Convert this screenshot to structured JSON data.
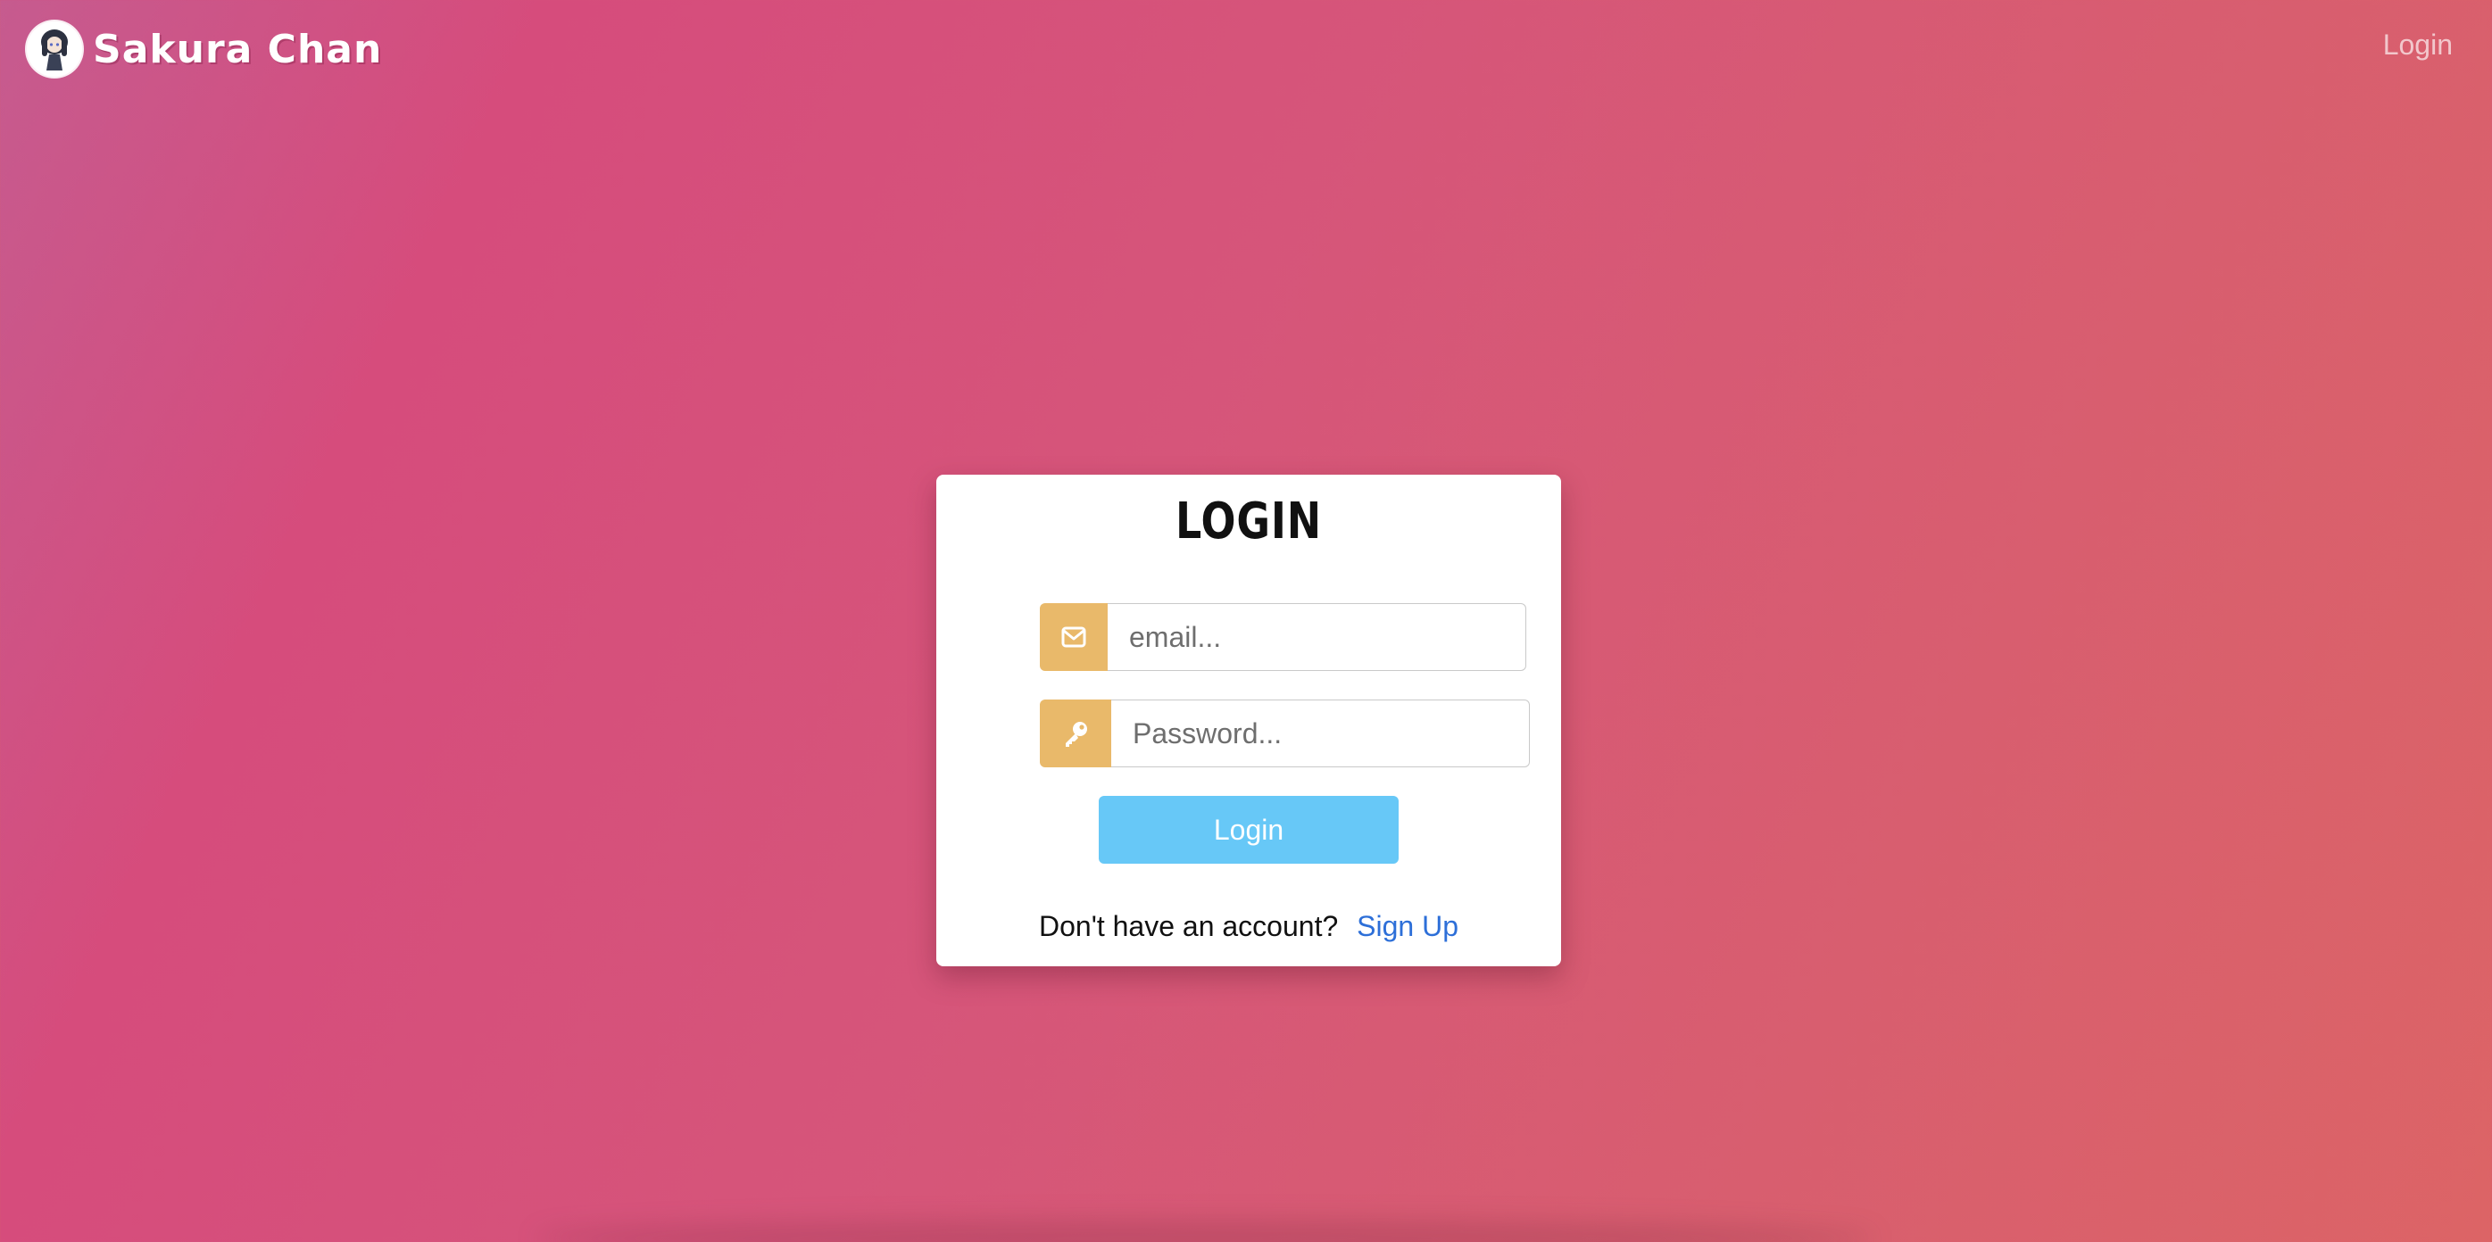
{
  "navbar": {
    "brand_name": "Sakura Chan",
    "logo_icon": "anime-avatar-icon",
    "login_link": "Login"
  },
  "login_card": {
    "title": "LOGIN",
    "email": {
      "icon": "envelope-icon",
      "placeholder": "email...",
      "value": ""
    },
    "password": {
      "icon": "key-icon",
      "placeholder": "Password...",
      "value": ""
    },
    "submit_label": "Login",
    "signup_prompt": "Don't have an account?",
    "signup_link": "Sign Up"
  },
  "colors": {
    "background_start": "#c65b8f",
    "background_end": "#dc6466",
    "addon": "#e9b96a",
    "button": "#67c8f7",
    "link": "#2d6fd8"
  }
}
